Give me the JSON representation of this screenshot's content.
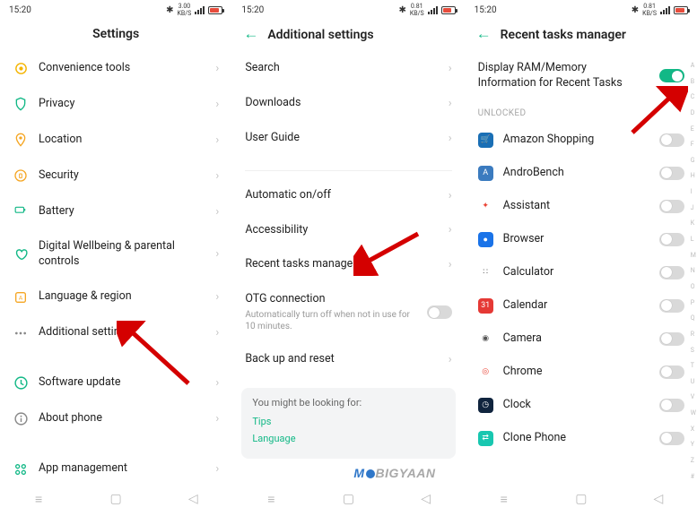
{
  "pane1": {
    "time": "15:20",
    "speed_top": "3.00",
    "speed_bot": "KB/S",
    "title": "Settings",
    "items": [
      {
        "label": "Convenience tools"
      },
      {
        "label": "Privacy"
      },
      {
        "label": "Location"
      },
      {
        "label": "Security"
      },
      {
        "label": "Battery"
      },
      {
        "label": "Digital Wellbeing & parental controls"
      },
      {
        "label": "Language & region"
      },
      {
        "label": "Additional settings"
      },
      {
        "label": "Software update"
      },
      {
        "label": "About phone"
      },
      {
        "label": "App management"
      }
    ]
  },
  "pane2": {
    "time": "15:20",
    "speed_top": "0.81",
    "speed_bot": "KB/S",
    "title": "Additional settings",
    "groupA": [
      {
        "label": "Search"
      },
      {
        "label": "Downloads"
      },
      {
        "label": "User Guide"
      }
    ],
    "groupB": [
      {
        "label": "Automatic on/off"
      },
      {
        "label": "Accessibility"
      },
      {
        "label": "Recent tasks manager"
      }
    ],
    "otg": {
      "label": "OTG connection",
      "sub": "Automatically turn off when not in use for 10 minutes."
    },
    "backup": {
      "label": "Back up and reset"
    },
    "hint": {
      "title": "You might be looking for:",
      "l1": "Tips",
      "l2": "Language"
    }
  },
  "pane3": {
    "time": "15:20",
    "speed_top": "0.81",
    "speed_bot": "KB/S",
    "title": "Recent tasks manager",
    "ram_label": "Display RAM/Memory Information for Recent Tasks",
    "section": "UNLOCKED",
    "apps": [
      {
        "label": "Amazon Shopping",
        "bg": "#1a6fb5",
        "glyph": "🛒"
      },
      {
        "label": "AndroBench",
        "bg": "#3b7bbf",
        "glyph": "A"
      },
      {
        "label": "Assistant",
        "bg": "#ffffff",
        "glyph": "✦",
        "fg": "#ea4335"
      },
      {
        "label": "Browser",
        "bg": "#1a73e8",
        "glyph": "●"
      },
      {
        "label": "Calculator",
        "bg": "#ffffff",
        "glyph": "∷",
        "fg": "#555"
      },
      {
        "label": "Calendar",
        "bg": "#e53935",
        "glyph": "31"
      },
      {
        "label": "Camera",
        "bg": "#ffffff",
        "glyph": "◉",
        "fg": "#555"
      },
      {
        "label": "Chrome",
        "bg": "#ffffff",
        "glyph": "◎",
        "fg": "#ea4335"
      },
      {
        "label": "Clock",
        "bg": "#10243e",
        "glyph": "◷"
      },
      {
        "label": "Clone Phone",
        "bg": "#18c7b0",
        "glyph": "⇄"
      }
    ],
    "alphabet": [
      "A",
      "B",
      "C",
      "D",
      "E",
      "F",
      "G",
      "H",
      "I",
      "J",
      "K",
      "L",
      "M",
      "N",
      "O",
      "P",
      "Q",
      "R",
      "S",
      "T",
      "U",
      "V",
      "W",
      "X",
      "Y",
      "Z",
      "#"
    ]
  },
  "watermark": {
    "a": "M",
    "b": "BIGYAAN"
  }
}
